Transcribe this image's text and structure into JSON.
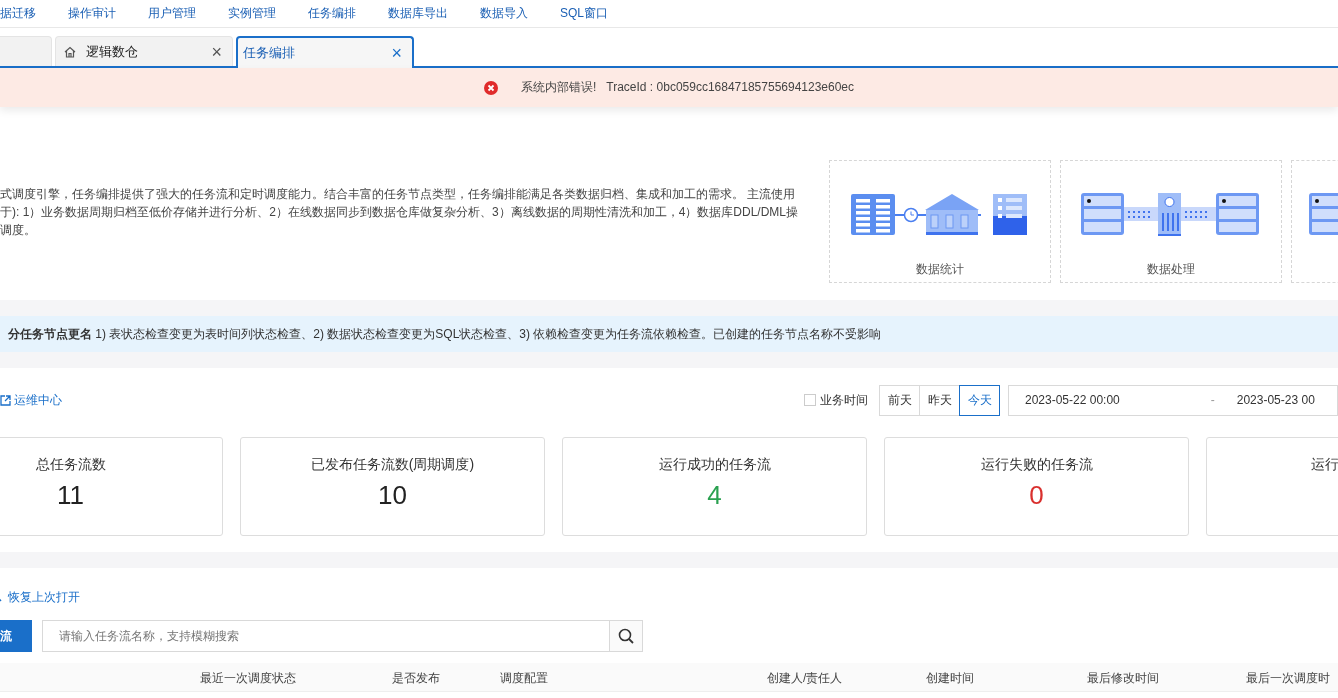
{
  "nav": {
    "items": [
      {
        "label": "据迁移"
      },
      {
        "label": "操作审计"
      },
      {
        "label": "用户管理"
      },
      {
        "label": "实例管理"
      },
      {
        "label": "任务编排"
      },
      {
        "label": "数据库导出"
      },
      {
        "label": "数据导入"
      },
      {
        "label": "SQL窗口"
      }
    ]
  },
  "tabs": [
    {
      "kind": "blank",
      "selected": false
    },
    {
      "kind": "home",
      "label": "逻辑数仓",
      "close": "×",
      "selected": false
    },
    {
      "kind": "plain",
      "label": "任务编排",
      "close": "×",
      "selected": true
    }
  ],
  "error": {
    "message": "系统内部错误!   TraceId : 0bc059cc16847185755694123e60ec"
  },
  "intro": {
    "description_lines": [
      "式调度引擎，任务编排提供了强大的任务流和定时调度能力。结合丰富的任务节点类型，任务编排能满足各类数据归档、集成和加工的需求。 主流使用",
      "于): 1）业务数据周期归档至低价存储并进行分析、2）在线数据同步到数据仓库做复杂分析、3）离线数据的周期性清洗和加工，4）数据库DDL/DML操",
      "调度。"
    ],
    "cards": [
      {
        "kind": "statistics",
        "label": "数据统计"
      },
      {
        "kind": "processing",
        "label": "数据处理"
      },
      {
        "kind": "partial"
      }
    ]
  },
  "notice": {
    "text": "**分任务节点更名** 1) 表状态检查变更为表时间列状态检查、2) 数据状态检查变更为SQL状态检查、3) 依赖检查变更为任务流依赖检查。已创建的任务节点名称不受影响"
  },
  "ops": {
    "link": "运维中心",
    "business_time": {
      "label": "业务时间",
      "checked": false
    },
    "day_buttons": [
      {
        "label": "前天",
        "selected": false
      },
      {
        "label": "昨天",
        "selected": false
      },
      {
        "label": "今天",
        "selected": true
      }
    ],
    "date_range": {
      "start": "2023-05-22 00:00",
      "separator": "-",
      "end": "2023-05-23 00"
    }
  },
  "stats": [
    {
      "label": "总任务流数",
      "value": "11",
      "color": "#222222"
    },
    {
      "label": "已发布任务流数(周期调度)",
      "value": "10",
      "color": "#222222"
    },
    {
      "label": "运行成功的任务流",
      "value": "4",
      "color": "#2aa150"
    },
    {
      "label": "运行失败的任务流",
      "value": "0",
      "color": "#d9302e"
    },
    {
      "label": "运行"
    }
  ],
  "flows": {
    "restore_link": "恢复上次打开",
    "create_button": "流",
    "search": {
      "placeholder": "请输入任务流名称，支持模糊搜索"
    },
    "columns": [
      "最近一次调度状态",
      "是否发布",
      "调度配置",
      "创建人/责任人",
      "创建时间",
      "最后修改时间",
      "最后一次调度时"
    ]
  }
}
